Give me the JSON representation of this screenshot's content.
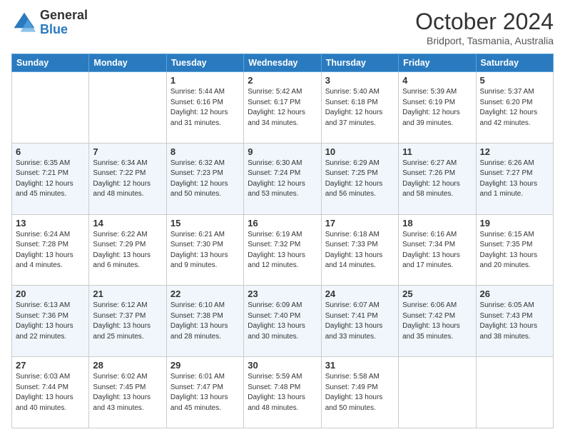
{
  "header": {
    "logo_general": "General",
    "logo_blue": "Blue",
    "month_title": "October 2024",
    "subtitle": "Bridport, Tasmania, Australia"
  },
  "days_of_week": [
    "Sunday",
    "Monday",
    "Tuesday",
    "Wednesday",
    "Thursday",
    "Friday",
    "Saturday"
  ],
  "weeks": [
    [
      {
        "day": "",
        "info": ""
      },
      {
        "day": "",
        "info": ""
      },
      {
        "day": "1",
        "info": "Sunrise: 5:44 AM\nSunset: 6:16 PM\nDaylight: 12 hours\nand 31 minutes."
      },
      {
        "day": "2",
        "info": "Sunrise: 5:42 AM\nSunset: 6:17 PM\nDaylight: 12 hours\nand 34 minutes."
      },
      {
        "day": "3",
        "info": "Sunrise: 5:40 AM\nSunset: 6:18 PM\nDaylight: 12 hours\nand 37 minutes."
      },
      {
        "day": "4",
        "info": "Sunrise: 5:39 AM\nSunset: 6:19 PM\nDaylight: 12 hours\nand 39 minutes."
      },
      {
        "day": "5",
        "info": "Sunrise: 5:37 AM\nSunset: 6:20 PM\nDaylight: 12 hours\nand 42 minutes."
      }
    ],
    [
      {
        "day": "6",
        "info": "Sunrise: 6:35 AM\nSunset: 7:21 PM\nDaylight: 12 hours\nand 45 minutes."
      },
      {
        "day": "7",
        "info": "Sunrise: 6:34 AM\nSunset: 7:22 PM\nDaylight: 12 hours\nand 48 minutes."
      },
      {
        "day": "8",
        "info": "Sunrise: 6:32 AM\nSunset: 7:23 PM\nDaylight: 12 hours\nand 50 minutes."
      },
      {
        "day": "9",
        "info": "Sunrise: 6:30 AM\nSunset: 7:24 PM\nDaylight: 12 hours\nand 53 minutes."
      },
      {
        "day": "10",
        "info": "Sunrise: 6:29 AM\nSunset: 7:25 PM\nDaylight: 12 hours\nand 56 minutes."
      },
      {
        "day": "11",
        "info": "Sunrise: 6:27 AM\nSunset: 7:26 PM\nDaylight: 12 hours\nand 58 minutes."
      },
      {
        "day": "12",
        "info": "Sunrise: 6:26 AM\nSunset: 7:27 PM\nDaylight: 13 hours\nand 1 minute."
      }
    ],
    [
      {
        "day": "13",
        "info": "Sunrise: 6:24 AM\nSunset: 7:28 PM\nDaylight: 13 hours\nand 4 minutes."
      },
      {
        "day": "14",
        "info": "Sunrise: 6:22 AM\nSunset: 7:29 PM\nDaylight: 13 hours\nand 6 minutes."
      },
      {
        "day": "15",
        "info": "Sunrise: 6:21 AM\nSunset: 7:30 PM\nDaylight: 13 hours\nand 9 minutes."
      },
      {
        "day": "16",
        "info": "Sunrise: 6:19 AM\nSunset: 7:32 PM\nDaylight: 13 hours\nand 12 minutes."
      },
      {
        "day": "17",
        "info": "Sunrise: 6:18 AM\nSunset: 7:33 PM\nDaylight: 13 hours\nand 14 minutes."
      },
      {
        "day": "18",
        "info": "Sunrise: 6:16 AM\nSunset: 7:34 PM\nDaylight: 13 hours\nand 17 minutes."
      },
      {
        "day": "19",
        "info": "Sunrise: 6:15 AM\nSunset: 7:35 PM\nDaylight: 13 hours\nand 20 minutes."
      }
    ],
    [
      {
        "day": "20",
        "info": "Sunrise: 6:13 AM\nSunset: 7:36 PM\nDaylight: 13 hours\nand 22 minutes."
      },
      {
        "day": "21",
        "info": "Sunrise: 6:12 AM\nSunset: 7:37 PM\nDaylight: 13 hours\nand 25 minutes."
      },
      {
        "day": "22",
        "info": "Sunrise: 6:10 AM\nSunset: 7:38 PM\nDaylight: 13 hours\nand 28 minutes."
      },
      {
        "day": "23",
        "info": "Sunrise: 6:09 AM\nSunset: 7:40 PM\nDaylight: 13 hours\nand 30 minutes."
      },
      {
        "day": "24",
        "info": "Sunrise: 6:07 AM\nSunset: 7:41 PM\nDaylight: 13 hours\nand 33 minutes."
      },
      {
        "day": "25",
        "info": "Sunrise: 6:06 AM\nSunset: 7:42 PM\nDaylight: 13 hours\nand 35 minutes."
      },
      {
        "day": "26",
        "info": "Sunrise: 6:05 AM\nSunset: 7:43 PM\nDaylight: 13 hours\nand 38 minutes."
      }
    ],
    [
      {
        "day": "27",
        "info": "Sunrise: 6:03 AM\nSunset: 7:44 PM\nDaylight: 13 hours\nand 40 minutes."
      },
      {
        "day": "28",
        "info": "Sunrise: 6:02 AM\nSunset: 7:45 PM\nDaylight: 13 hours\nand 43 minutes."
      },
      {
        "day": "29",
        "info": "Sunrise: 6:01 AM\nSunset: 7:47 PM\nDaylight: 13 hours\nand 45 minutes."
      },
      {
        "day": "30",
        "info": "Sunrise: 5:59 AM\nSunset: 7:48 PM\nDaylight: 13 hours\nand 48 minutes."
      },
      {
        "day": "31",
        "info": "Sunrise: 5:58 AM\nSunset: 7:49 PM\nDaylight: 13 hours\nand 50 minutes."
      },
      {
        "day": "",
        "info": ""
      },
      {
        "day": "",
        "info": ""
      }
    ]
  ]
}
